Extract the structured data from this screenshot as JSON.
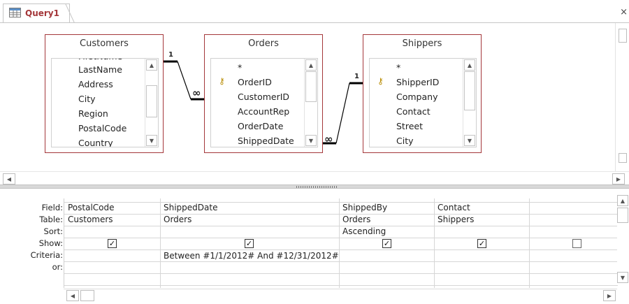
{
  "tab": {
    "title": "Query1",
    "close_glyph": "×"
  },
  "tables": [
    {
      "name": "Customers",
      "fields": [
        "FirstName",
        "LastName",
        "Address",
        "City",
        "Region",
        "PostalCode",
        "Country"
      ]
    },
    {
      "name": "Orders",
      "fields": [
        "*",
        "OrderID",
        "CustomerID",
        "AccountRep",
        "OrderDate",
        "ShippedDate"
      ]
    },
    {
      "name": "Shippers",
      "fields": [
        "*",
        "ShipperID",
        "Company",
        "Contact",
        "Street",
        "City"
      ]
    }
  ],
  "relationships": [
    {
      "from": "Customers",
      "to": "Orders",
      "from_end": "1",
      "to_end": "∞"
    },
    {
      "from": "Shippers",
      "to": "Orders",
      "from_end": "1",
      "to_end": "∞"
    }
  ],
  "grid": {
    "row_labels": [
      "Field:",
      "Table:",
      "Sort:",
      "Show:",
      "Criteria:",
      "or:"
    ],
    "columns": [
      {
        "field": "PostalCode",
        "table": "Customers",
        "sort": "",
        "show": true,
        "criteria": "",
        "or": ""
      },
      {
        "field": "ShippedDate",
        "table": "Orders",
        "sort": "",
        "show": true,
        "criteria": "Between #1/1/2012# And #12/31/2012#",
        "or": ""
      },
      {
        "field": "ShippedBy",
        "table": "Orders",
        "sort": "Ascending",
        "show": true,
        "criteria": "",
        "or": ""
      },
      {
        "field": "Contact",
        "table": "Shippers",
        "sort": "",
        "show": true,
        "criteria": "",
        "or": ""
      },
      {
        "field": "",
        "table": "",
        "sort": "",
        "show": false,
        "criteria": "",
        "or": ""
      }
    ]
  },
  "colors": {
    "accent": "#a4373a",
    "key": "#b78b00"
  }
}
